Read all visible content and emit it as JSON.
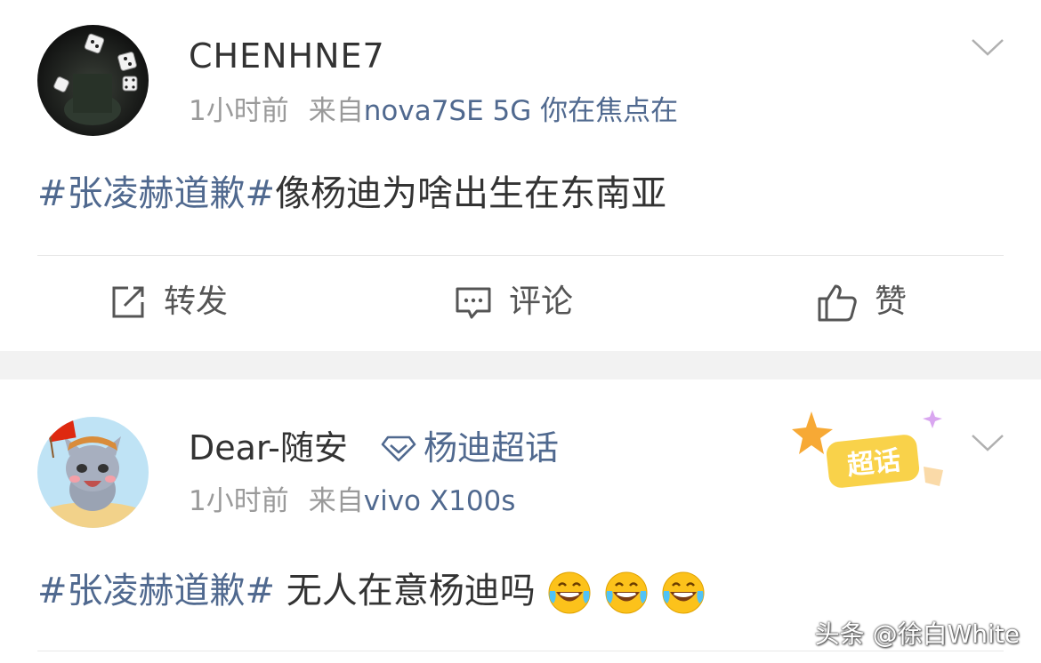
{
  "posts": [
    {
      "username": "CHENHNE7",
      "time": "1小时前",
      "source_prefix": "来自",
      "device": "nova7SE 5G 你在焦点在",
      "hashtag": "#张凌赫道歉#",
      "text": "像杨迪为啥出生在东南亚",
      "actions": {
        "repost": "转发",
        "comment": "评论",
        "like": "赞"
      }
    },
    {
      "username": "Dear-随安",
      "supertopic": "杨迪超话",
      "badge": "超话",
      "time": "1小时前",
      "source_prefix": "来自",
      "device": "vivo X100s",
      "hashtag": "#张凌赫道歉#",
      "text": " 无人在意杨迪吗",
      "emoji_count": 3
    }
  ],
  "watermark": "头条 @徐白White",
  "colors": {
    "link": "#50698f",
    "meta": "#9a9a9a",
    "text": "#333333",
    "separator": "#f2f2f2"
  },
  "icons": [
    "chevron-down-icon",
    "repost-icon",
    "comment-icon",
    "like-icon",
    "diamond-icon",
    "laugh-cry-emoji"
  ]
}
